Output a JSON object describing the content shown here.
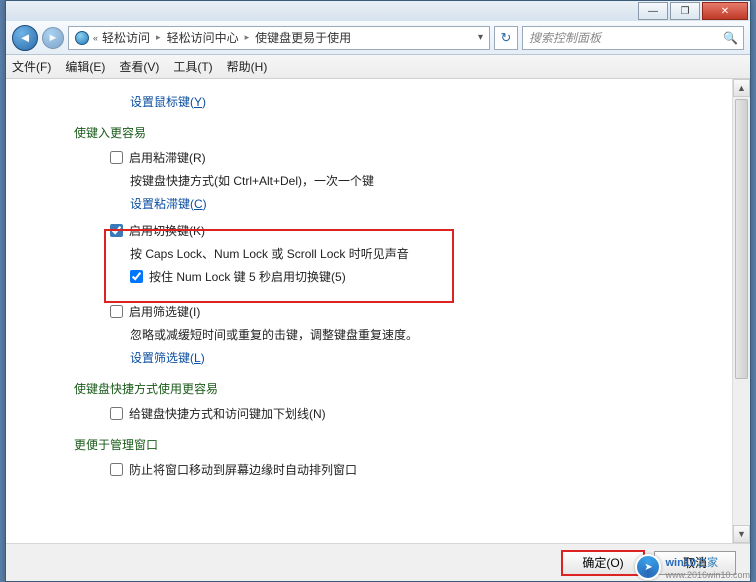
{
  "titlebar": {
    "min": "—",
    "max": "❐",
    "close": "✕"
  },
  "nav": {
    "crumb1": "轻松访问",
    "crumb2": "轻松访问中心",
    "crumb3": "使键盘更易于使用",
    "search_placeholder": "搜索控制面板"
  },
  "menu": {
    "file": "文件(F)",
    "edit": "编辑(E)",
    "view": "查看(V)",
    "tools": "工具(T)",
    "help": "帮助(H)"
  },
  "body": {
    "top_link": "设置鼠标键(",
    "top_link_u": "Y",
    "top_link_end": ")",
    "sec1": "使键入更容易",
    "cb1": "启用粘滞键(R)",
    "desc1": "按键盘快捷方式(如 Ctrl+Alt+Del)，一次一个键",
    "link1": "设置粘滞键(",
    "link1_u": "C",
    "link1_end": ")",
    "cb2": "启用切换键(K)",
    "desc2": "按 Caps Lock、Num Lock 或 Scroll Lock 时听见声音",
    "cb2b": "按住 Num Lock 键 5 秒启用切换键(5)",
    "cb3": "启用筛选键(I)",
    "desc3": "忽略或减缓短时间或重复的击键，调整键盘重复速度。",
    "link3": "设置筛选键(",
    "link3_u": "L",
    "link3_end": ")",
    "sec2": "使键盘快捷方式使用更容易",
    "cb4": "给键盘快捷方式和访问键加下划线(N)",
    "sec3": "更便于管理窗口",
    "cb5": "防止将窗口移动到屏幕边缘时自动排列窗口"
  },
  "footer": {
    "ok": "确定(O)",
    "cancel": "取消"
  },
  "watermark": {
    "brand": "win10",
    "suffix": "之家",
    "url": "www.2016win10.com"
  }
}
